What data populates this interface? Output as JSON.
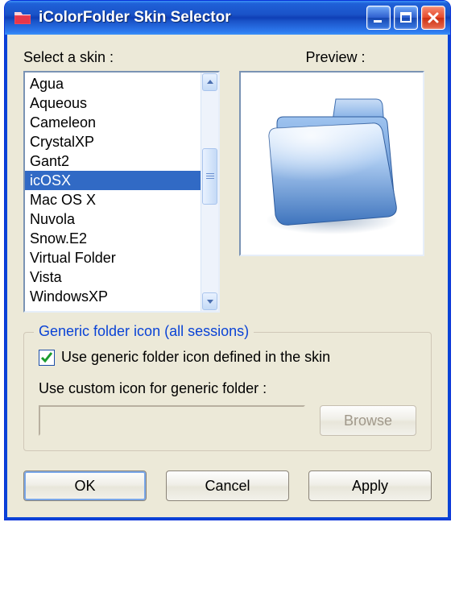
{
  "window": {
    "title": "iColorFolder Skin Selector"
  },
  "labels": {
    "select_skin": "Select a skin :",
    "preview": "Preview :"
  },
  "skins": {
    "items": [
      {
        "label": "Agua",
        "selected": false
      },
      {
        "label": "Aqueous",
        "selected": false
      },
      {
        "label": "Cameleon",
        "selected": false
      },
      {
        "label": "CrystalXP",
        "selected": false
      },
      {
        "label": "Gant2",
        "selected": false
      },
      {
        "label": "icOSX",
        "selected": true
      },
      {
        "label": "Mac OS X",
        "selected": false
      },
      {
        "label": "Nuvola",
        "selected": false
      },
      {
        "label": "Snow.E2",
        "selected": false
      },
      {
        "label": "Virtual Folder",
        "selected": false
      },
      {
        "label": "Vista",
        "selected": false
      },
      {
        "label": "WindowsXP",
        "selected": false
      }
    ]
  },
  "group": {
    "legend": "Generic folder icon (all sessions)",
    "use_generic_checked": true,
    "use_generic_label": "Use generic folder icon defined in the skin",
    "custom_label": "Use custom icon for generic folder :",
    "custom_path": "",
    "browse_label": "Browse",
    "browse_enabled": false
  },
  "buttons": {
    "ok": "OK",
    "cancel": "Cancel",
    "apply": "Apply"
  }
}
